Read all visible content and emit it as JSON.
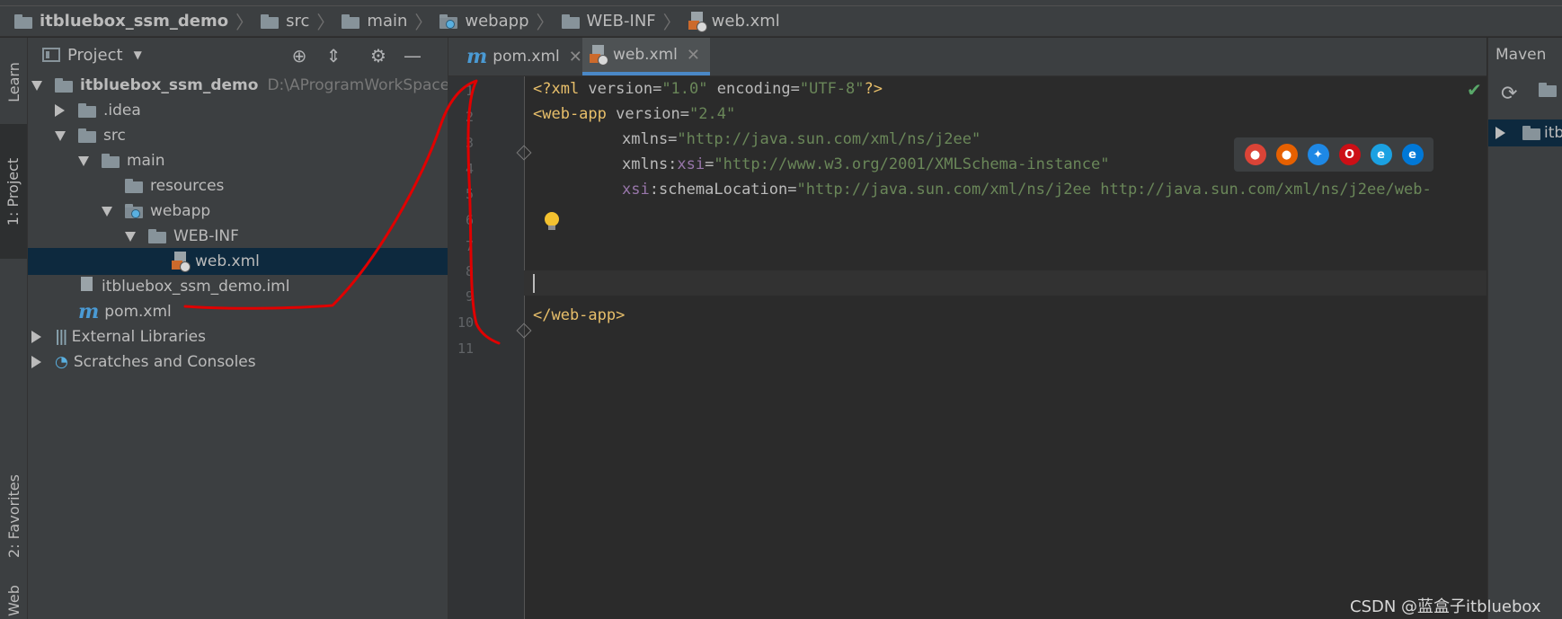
{
  "breadcrumb": [
    "itbluebox_ssm_demo",
    "src",
    "main",
    "webapp",
    "WEB-INF",
    "web.xml"
  ],
  "left_strip": {
    "learn": "Learn",
    "project": "1: Project",
    "favorites": "2: Favorites",
    "web": "Web"
  },
  "project_panel": {
    "title": "Project",
    "tree": {
      "root": "itbluebox_ssm_demo",
      "root_path": "D:\\AProgramWorkSpace\\id",
      "idea": ".idea",
      "src": "src",
      "main": "main",
      "resources": "resources",
      "webapp": "webapp",
      "webinf": "WEB-INF",
      "webxml": "web.xml",
      "iml": "itbluebox_ssm_demo.iml",
      "pom": "pom.xml",
      "external": "External Libraries",
      "scratches": "Scratches and Consoles"
    }
  },
  "editor": {
    "tabs": [
      {
        "label": "pom.xml",
        "active": false
      },
      {
        "label": "web.xml",
        "active": true
      }
    ],
    "line_numbers": [
      "1",
      "2",
      "3",
      "4",
      "5",
      "6",
      "7",
      "8",
      "9",
      "10",
      "11"
    ],
    "code": {
      "l1_pi_open": "<?xml ",
      "l1_a1": "version=",
      "l1_v1": "\"1.0\"",
      "l1_a2": " encoding=",
      "l1_v2": "\"UTF-8\"",
      "l1_pi_close": "?>",
      "l2_tag": "<web-app",
      "l2_attr": " version=",
      "l2_val": "\"2.4\"",
      "l3_attr": "xmlns=",
      "l3_val": "\"http://java.sun.com/xml/ns/j2ee\"",
      "l4_attr": "xmlns:",
      "l4_ns": "xsi",
      "l4_eq": "=",
      "l4_val": "\"http://www.w3.org/2001/XMLSchema-instance\"",
      "l5_ns": "xsi",
      "l5_attr": ":schemaLocation=",
      "l5_val": "\"http://java.sun.com/xml/ns/j2ee http://java.sun.com/xml/ns/j2ee/web-",
      "l10_tag": "</web-app>"
    },
    "browsers": [
      "chrome-icon",
      "firefox-icon",
      "safari-icon",
      "opera-icon",
      "ie-icon",
      "edge-icon"
    ]
  },
  "maven": {
    "title": "Maven",
    "item": "itb"
  },
  "watermark": "CSDN @蓝盒子itbluebox",
  "colors": {
    "tag": "#e8bf6a",
    "string": "#6a8759",
    "namespace": "#9876aa",
    "selection": "#0d293e",
    "annotation": "#e00000"
  }
}
